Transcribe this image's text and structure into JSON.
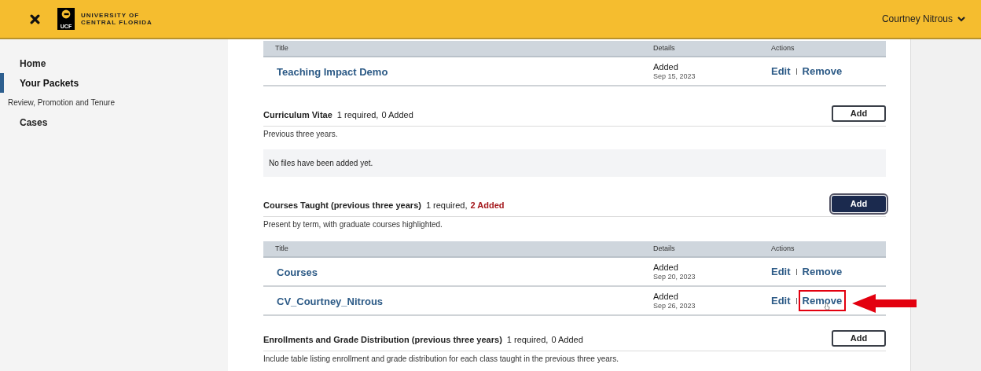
{
  "header": {
    "logo_mark": "UCF",
    "logo_line_1": "UNIVERSITY OF",
    "logo_line_2": "CENTRAL FLORIDA",
    "user": "Courtney Nitrous"
  },
  "sidebar": {
    "items": [
      {
        "kind": "link",
        "label": "Home",
        "selected": false
      },
      {
        "kind": "link",
        "label": "Your Packets",
        "selected": true
      },
      {
        "kind": "heading",
        "label": "Review, Promotion and Tenure"
      },
      {
        "kind": "link",
        "label": "Cases",
        "selected": false
      }
    ]
  },
  "blocks": [
    {
      "kind": "table",
      "columns": [
        "Title",
        "Details",
        "Actions"
      ],
      "rows": [
        {
          "title": "Teaching Impact Demo",
          "status": "Added",
          "date": "Sep 15, 2023",
          "edit": "Edit",
          "remove": "Remove",
          "remove_highlighted": false
        }
      ]
    },
    {
      "kind": "section",
      "title": "Curriculum Vitae",
      "requirement": "1 required,",
      "added": "0 Added",
      "added_alert": false,
      "button": "Add",
      "button_focused": false,
      "description": "Previous three years."
    },
    {
      "kind": "empty",
      "message": "No files have been added yet."
    },
    {
      "kind": "section",
      "title": "Courses Taught (previous three years)",
      "requirement": "1 required,",
      "added": "2 Added",
      "added_alert": true,
      "button": "Add",
      "button_focused": true,
      "description": "Present by term, with graduate courses highlighted."
    },
    {
      "kind": "table",
      "columns": [
        "Title",
        "Details",
        "Actions"
      ],
      "rows": [
        {
          "title": "Courses",
          "status": "Added",
          "date": "Sep 20, 2023",
          "edit": "Edit",
          "remove": "Remove",
          "remove_highlighted": false
        },
        {
          "title": "CV_Courtney_Nitrous",
          "status": "Added",
          "date": "Sep 26, 2023",
          "edit": "Edit",
          "remove": "Remove",
          "remove_highlighted": true
        }
      ]
    },
    {
      "kind": "section",
      "title": "Enrollments and Grade Distribution (previous three years)",
      "requirement": "1 required,",
      "added": "0 Added",
      "added_alert": false,
      "button": "Add",
      "button_focused": false,
      "description": "Include table listing enrollment and grade distribution for each class taught in the previous three years."
    }
  ]
}
